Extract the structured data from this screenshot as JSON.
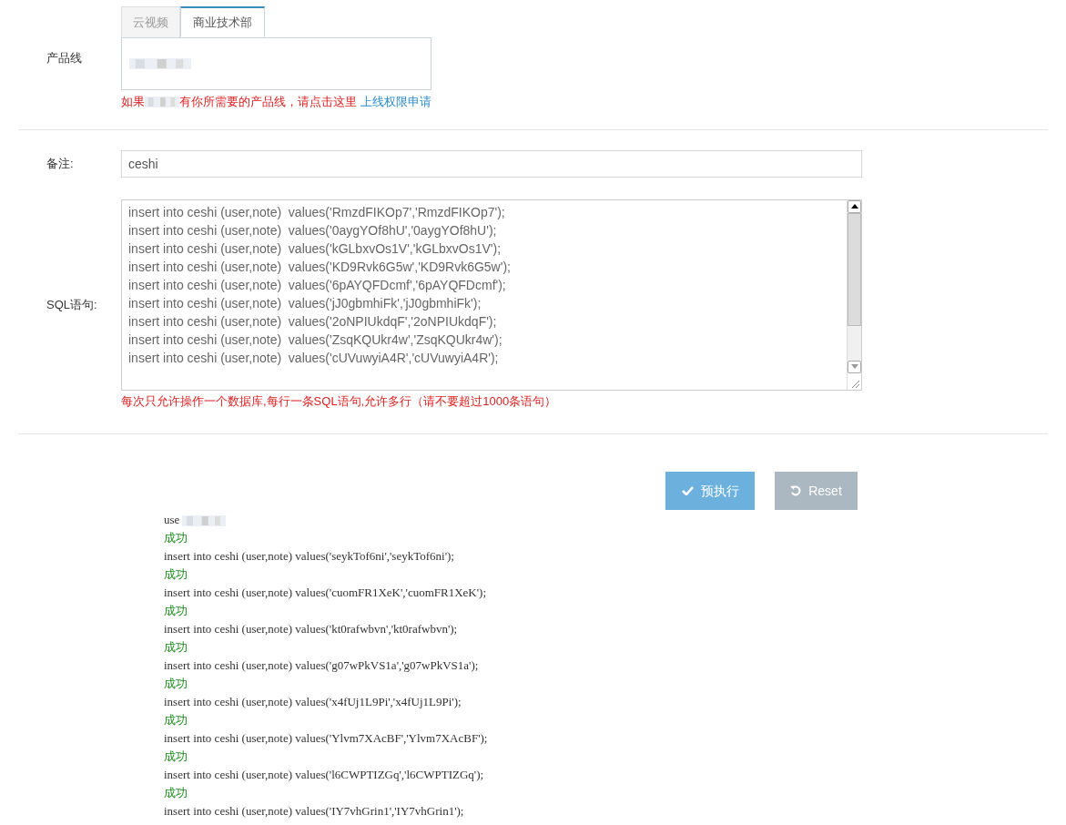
{
  "product_line": {
    "label": "产品线",
    "tabs": [
      {
        "label": "云视频",
        "selected": false
      },
      {
        "label": "商业技术部",
        "selected": true
      }
    ],
    "help": {
      "before": "如果",
      "after": "有你所需要的产品线，请点击这里",
      "link": "上线权限申请"
    }
  },
  "note": {
    "label": "备注:",
    "value": "ceshi"
  },
  "sql": {
    "label": "SQL语句:",
    "lines": [
      "insert into ceshi (user,note)  values('RmzdFIKOp7','RmzdFIKOp7');",
      "insert into ceshi (user,note)  values('0aygYOf8hU','0aygYOf8hU');",
      "insert into ceshi (user,note)  values('kGLbxvOs1V','kGLbxvOs1V');",
      "insert into ceshi (user,note)  values('KD9Rvk6G5w','KD9Rvk6G5w');",
      "insert into ceshi (user,note)  values('6pAYQFDcmf','6pAYQFDcmf');",
      "insert into ceshi (user,note)  values('jJ0gbmhiFk','jJ0gbmhiFk');",
      "insert into ceshi (user,note)  values('2oNPIUkdqF','2oNPIUkdqF');",
      "insert into ceshi (user,note)  values('ZsqKQUkr4w','ZsqKQUkr4w');",
      "insert into ceshi (user,note)  values('cUVuwyiA4R','cUVuwyiA4R');"
    ],
    "hint": "每次只允许操作一个数据库,每行一条SQL语句,允许多行（请不要超过1000条语句）"
  },
  "buttons": [
    {
      "kind": "primary",
      "label": "预执行"
    },
    {
      "kind": "reset",
      "label": "Reset"
    }
  ],
  "results": [
    {
      "kind": "statement",
      "text": "use",
      "redacted": true
    },
    {
      "kind": "status",
      "text": "成功"
    },
    {
      "kind": "statement",
      "text": "insert into ceshi (user,note) values('seykTof6ni','seykTof6ni');"
    },
    {
      "kind": "status",
      "text": "成功"
    },
    {
      "kind": "statement",
      "text": "insert into ceshi (user,note) values('cuomFR1XeK','cuomFR1XeK');"
    },
    {
      "kind": "status",
      "text": "成功"
    },
    {
      "kind": "statement",
      "text": "insert into ceshi (user,note) values('kt0rafwbvn','kt0rafwbvn');"
    },
    {
      "kind": "status",
      "text": "成功"
    },
    {
      "kind": "statement",
      "text": "insert into ceshi (user,note) values('g07wPkVS1a','g07wPkVS1a');"
    },
    {
      "kind": "status",
      "text": "成功"
    },
    {
      "kind": "statement",
      "text": "insert into ceshi (user,note) values('x4fUj1L9Pi','x4fUj1L9Pi');"
    },
    {
      "kind": "status",
      "text": "成功"
    },
    {
      "kind": "statement",
      "text": "insert into ceshi (user,note) values('Ylvm7XAcBF','Ylvm7XAcBF');"
    },
    {
      "kind": "status",
      "text": "成功"
    },
    {
      "kind": "statement",
      "text": "insert into ceshi (user,note) values('l6CWPTIZGq','l6CWPTIZGq');"
    },
    {
      "kind": "status",
      "text": "成功"
    },
    {
      "kind": "statement",
      "text": "insert into ceshi (user,note) values('IY7vhGrin1','IY7vhGrin1');"
    }
  ]
}
